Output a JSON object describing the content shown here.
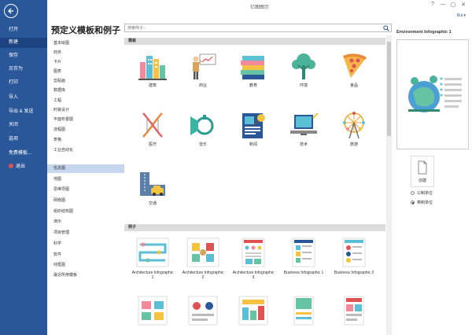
{
  "app": {
    "title": "亿图图示",
    "user": "Rui ▾",
    "window_controls": [
      "?",
      "—",
      "▢",
      "✕"
    ]
  },
  "left_nav": {
    "items": [
      {
        "label": "打开"
      },
      {
        "label": "新建",
        "active": true
      },
      {
        "label": "保存"
      },
      {
        "label": "另存为"
      },
      {
        "label": "打印"
      },
      {
        "label": "导入"
      },
      {
        "label": "导出 & 发送"
      },
      {
        "label": "关闭"
      },
      {
        "label": "选项"
      },
      {
        "label": "免费模板..."
      },
      {
        "label": "退出"
      }
    ]
  },
  "categories": {
    "heading": "预定义模板和例子",
    "items": [
      "基本绘图",
      "商务",
      "卡片",
      "图表",
      "剪贴画",
      "数据库",
      "工程",
      "时装设计",
      "平面布置图",
      "流程图",
      "表格",
      "工业自动化",
      "信息图",
      "地图",
      "思维导图",
      "网络图",
      "组织结构图",
      "演示",
      "项目管理",
      "科学",
      "软件",
      "线框图",
      "最近所用模板"
    ],
    "active_index": 12
  },
  "search": {
    "placeholder": "搜索例子..."
  },
  "templates_section": {
    "title": "模板",
    "tiles": [
      {
        "label": "建筑"
      },
      {
        "label": "商业"
      },
      {
        "label": "教育"
      },
      {
        "label": "环境"
      },
      {
        "label": "食品"
      },
      {
        "label": "医疗"
      },
      {
        "label": "音乐"
      },
      {
        "label": "新闻"
      },
      {
        "label": "技术"
      },
      {
        "label": "旅游"
      },
      {
        "label": "交通"
      }
    ]
  },
  "examples_section": {
    "title": "例子",
    "tiles": [
      {
        "label": "Architecture Infographic 1"
      },
      {
        "label": "Architecture Infographic 2"
      },
      {
        "label": "Architecture Infographic 3"
      },
      {
        "label": "Business Infographic 1"
      },
      {
        "label": "Business Infographic 2"
      }
    ]
  },
  "preview": {
    "title": "Environment Infographic 1",
    "create_label": "创建",
    "units": [
      {
        "label": "公制单位",
        "selected": false
      },
      {
        "label": "英制单位",
        "selected": true
      }
    ]
  },
  "colors": {
    "sidebar": "#2a579a",
    "sidebar_active": "#1b4480",
    "category_active": "#c6d6ee",
    "section_bar": "#dcdcdc"
  }
}
